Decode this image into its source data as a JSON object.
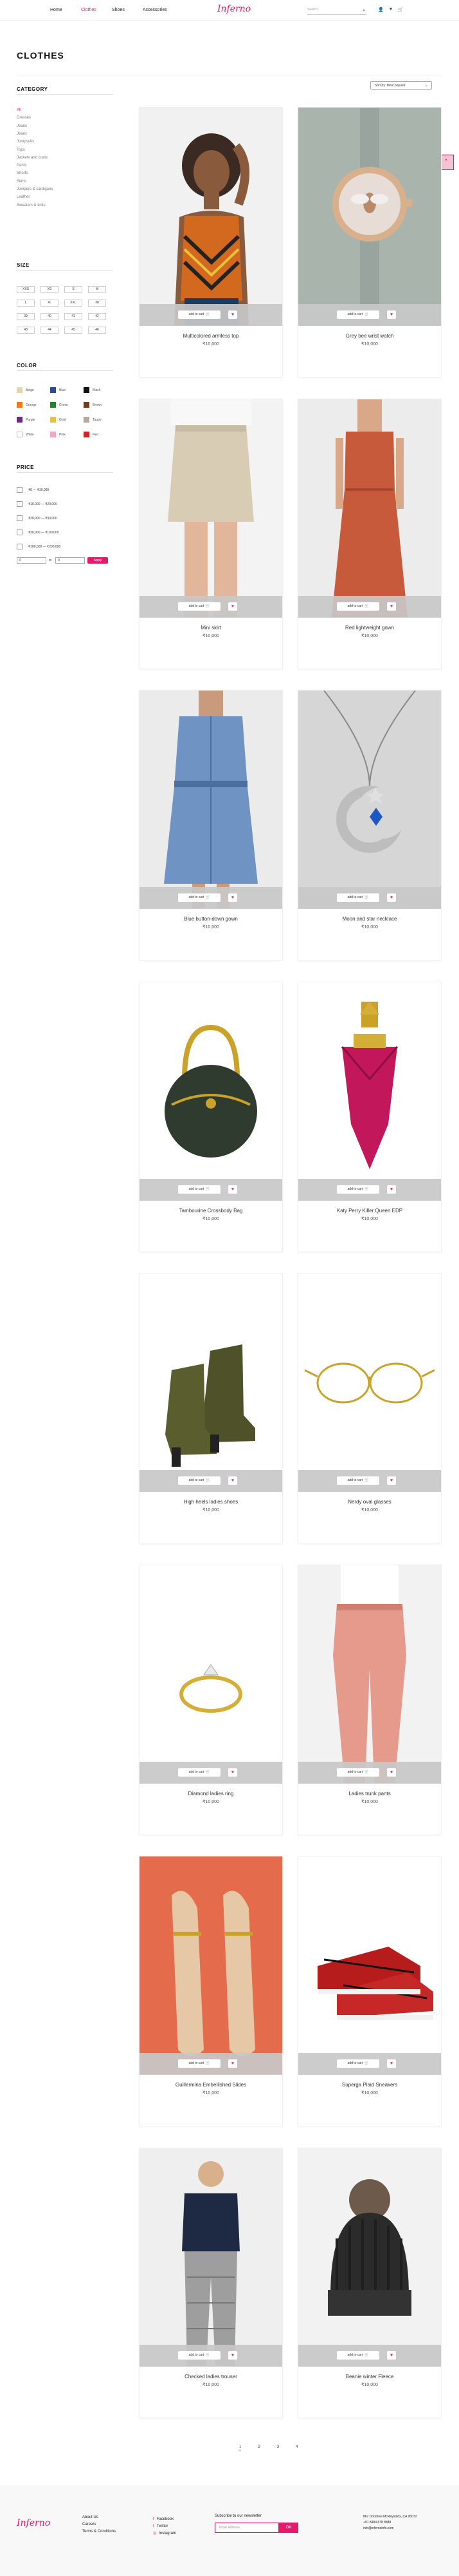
{
  "header": {
    "nav": [
      "Home",
      "Clothes",
      "Shoes",
      "Accessories"
    ],
    "active_nav": "Clothes",
    "logo": "Inferno",
    "search_placeholder": "Search..."
  },
  "page_title": "CLOTHES",
  "sort_label": "Sort by: Most popular",
  "sidebar": {
    "category_title": "CATEGORY",
    "categories": [
      "All",
      "Dresses",
      "Jeans",
      "Jeans",
      "Jumpsuits",
      "Tops",
      "Jackets and coats",
      "Pants",
      "Shorts",
      "Skirts",
      "Jumpers & cardigans",
      "Leather",
      "Sweaters & knits"
    ],
    "size_title": "SIZE",
    "sizes": [
      "XXS",
      "XS",
      "S",
      "M",
      "L",
      "XL",
      "XXL",
      "38",
      "39",
      "40",
      "41",
      "42",
      "43",
      "44",
      "45",
      "46"
    ],
    "color_title": "COLOR",
    "colors": [
      {
        "label": "Beige",
        "hex": "#e8d5b0"
      },
      {
        "label": "Blue",
        "hex": "#2b4a9c"
      },
      {
        "label": "Black",
        "hex": "#111111"
      },
      {
        "label": "Orange",
        "hex": "#e87a2a"
      },
      {
        "label": "Green",
        "hex": "#2e7d32"
      },
      {
        "label": "Brown",
        "hex": "#6b3e26"
      },
      {
        "label": "Purple",
        "hex": "#6a2a8a"
      },
      {
        "label": "Gold",
        "hex": "#e8c23a"
      },
      {
        "label": "Taupe",
        "hex": "#b8a89a"
      },
      {
        "label": "White",
        "hex": "#ffffff"
      },
      {
        "label": "Pink",
        "hex": "#f2a6c0"
      },
      {
        "label": "Red",
        "hex": "#c62828"
      }
    ],
    "price_title": "PRICE",
    "price_ranges": [
      "₹0 — ₹10,000",
      "₹10,000 — ₹20,000",
      "₹20,000 — ₹30,000",
      "₹30,000 — ₹100,000",
      "₹100,000 — ₹200,000"
    ],
    "price_from": "0",
    "price_to_label": "to",
    "price_to": "0",
    "apply_label": "Apply"
  },
  "products": [
    {
      "name": "Multicolored armless top",
      "price": "₹10,000",
      "img": "top"
    },
    {
      "name": "Grey bee wrist watch",
      "price": "₹10,000",
      "img": "watch"
    },
    {
      "name": "Mini skirt",
      "price": "₹10,000",
      "img": "skirt"
    },
    {
      "name": "Red lightweight gown",
      "price": "₹10,000",
      "img": "gown"
    },
    {
      "name": "Blue button-down gown",
      "price": "₹10,000",
      "img": "denim"
    },
    {
      "name": "Moon and star necklace",
      "price": "₹10,000",
      "img": "necklace"
    },
    {
      "name": "Tambourine Crossbody Bag",
      "price": "₹10,000",
      "img": "bag"
    },
    {
      "name": "Katy Perry Killer Queen EDP",
      "price": "₹10,000",
      "img": "perfume"
    },
    {
      "name": "High heels ladies shoes",
      "price": "₹10,000",
      "img": "boots"
    },
    {
      "name": "Nerdy oval glasses",
      "price": "₹10,000",
      "img": "glasses"
    },
    {
      "name": "Diamond ladies ring",
      "price": "₹10,000",
      "img": "ring"
    },
    {
      "name": "Ladies trunk pants",
      "price": "₹10,000",
      "img": "pants"
    },
    {
      "name": "Guillermina Embellished Slides",
      "price": "₹10,000",
      "img": "slides"
    },
    {
      "name": "Superga Plaid Sneakers",
      "price": "₹10,000",
      "img": "sneakers"
    },
    {
      "name": "Checked ladies trouser",
      "price": "₹10,000",
      "img": "trouser"
    },
    {
      "name": "Beanie winter Fleece",
      "price": "₹10,000",
      "img": "beanie"
    }
  ],
  "add_to_cart_label": "add to cart",
  "pagination": [
    "1",
    "2",
    "3",
    "4"
  ],
  "pagination_current": "1",
  "footer": {
    "logo": "Inferno",
    "links": [
      "About Us",
      "Careers",
      "Terms & Conditions"
    ],
    "social": [
      "Facebook",
      "Twitter",
      "Instagram"
    ],
    "subscribe_title": "Subscribe to our newsletter",
    "email_placeholder": "Email Address",
    "ok_label": "OK",
    "address": [
      "867 Dondrew McReynolds, CA 95072",
      "+91 8484 878 8888",
      "info@infernoinfo.com"
    ]
  },
  "accent": "#e6196b"
}
